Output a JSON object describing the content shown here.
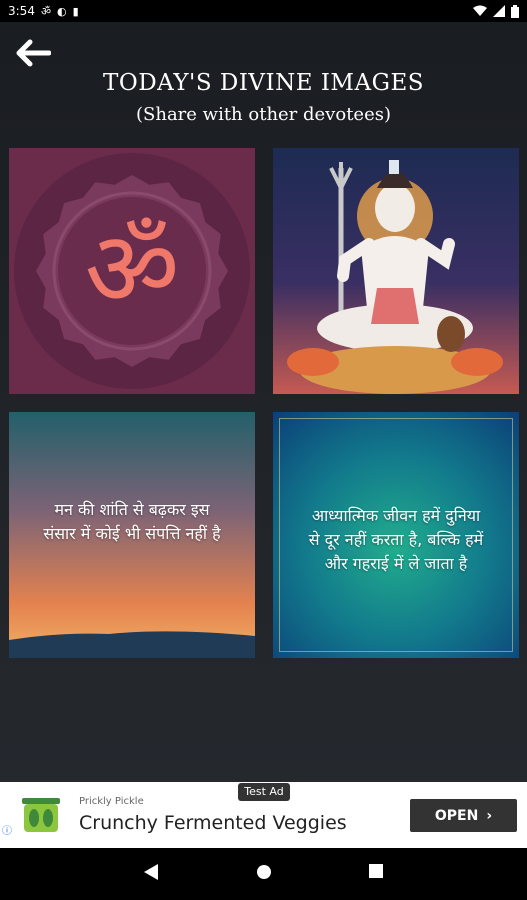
{
  "status_bar": {
    "time": "3:54"
  },
  "header": {
    "title": "TODAY'S DIVINE IMAGES",
    "subtitle": "(Share with other devotees)"
  },
  "tiles": [
    {
      "type": "image",
      "subject": "om-symbol"
    },
    {
      "type": "image",
      "subject": "lord-shiva-statue"
    },
    {
      "type": "quote",
      "lines": [
        "मन की शांति से बढ़कर इस",
        "संसार में कोई भी संपत्ति नहीं है"
      ]
    },
    {
      "type": "quote",
      "lines": [
        "आध्यात्मिक जीवन हमें दुनिया",
        "से दूर नहीं करता है, बल्कि हमें",
        "और गहराई में ले जाता है"
      ]
    }
  ],
  "ad": {
    "badge": "Test Ad",
    "advertiser": "Prickly Pickle",
    "headline": "Crunchy Fermented Veggies",
    "cta": "OPEN"
  },
  "colors": {
    "background": "#1e2125",
    "om_tile": "#6b2c4c",
    "om_symbol": "#f0786a",
    "ad_button": "#333333"
  },
  "icons": {
    "back": "arrow-left-icon",
    "nav_back": "triangle-back-icon",
    "nav_home": "circle-home-icon",
    "nav_recents": "square-recents-icon"
  }
}
